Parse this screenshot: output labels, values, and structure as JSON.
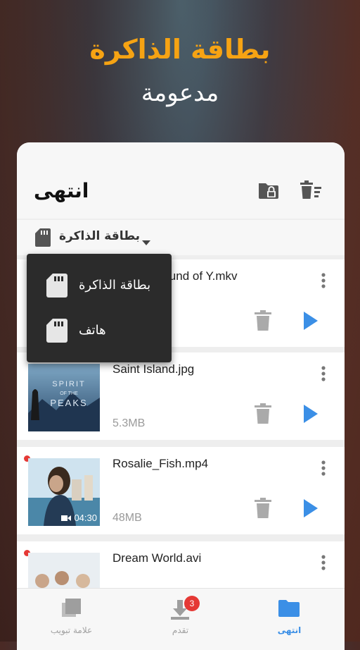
{
  "promo": {
    "title": "بطاقة الذاكرة",
    "subtitle": "مدعومة"
  },
  "appbar": {
    "title": "انتهى",
    "icons": [
      "folder-lock-icon",
      "delete-sort-icon"
    ]
  },
  "storage_selector": {
    "label": "بطاقة الذاكرة",
    "icon": "sd-card-icon"
  },
  "dropdown": {
    "items": [
      {
        "label": "بطاقة الذاكرة",
        "icon": "sd-card-icon"
      },
      {
        "label": "هاتف",
        "icon": "sd-card-icon"
      }
    ]
  },
  "files": [
    {
      "name": "Sound of Y.mkv",
      "size": "",
      "duration": "",
      "new": false,
      "thumb_text": ""
    },
    {
      "name": "Saint Island.jpg",
      "size": "5.3MB",
      "duration": "",
      "new": false,
      "thumb_text": "SPIRIT OF THE PEAKS"
    },
    {
      "name": "Rosalie_Fish.mp4",
      "size": "48MB",
      "duration": "04:30",
      "new": true,
      "thumb_text": ""
    },
    {
      "name": "Dream World.avi",
      "size": "",
      "duration": "",
      "new": true,
      "thumb_text": ""
    }
  ],
  "bottom_nav": {
    "items": [
      {
        "label": "علامة تبويب",
        "icon": "tabs-icon",
        "active": false
      },
      {
        "label": "تقدم",
        "icon": "download-icon",
        "active": false,
        "badge": "3"
      },
      {
        "label": "انتهى",
        "icon": "folder-icon",
        "active": true
      }
    ]
  },
  "colors": {
    "accent": "#3b8fe6",
    "promo_title": "#f6a313",
    "badge": "#e53935"
  }
}
